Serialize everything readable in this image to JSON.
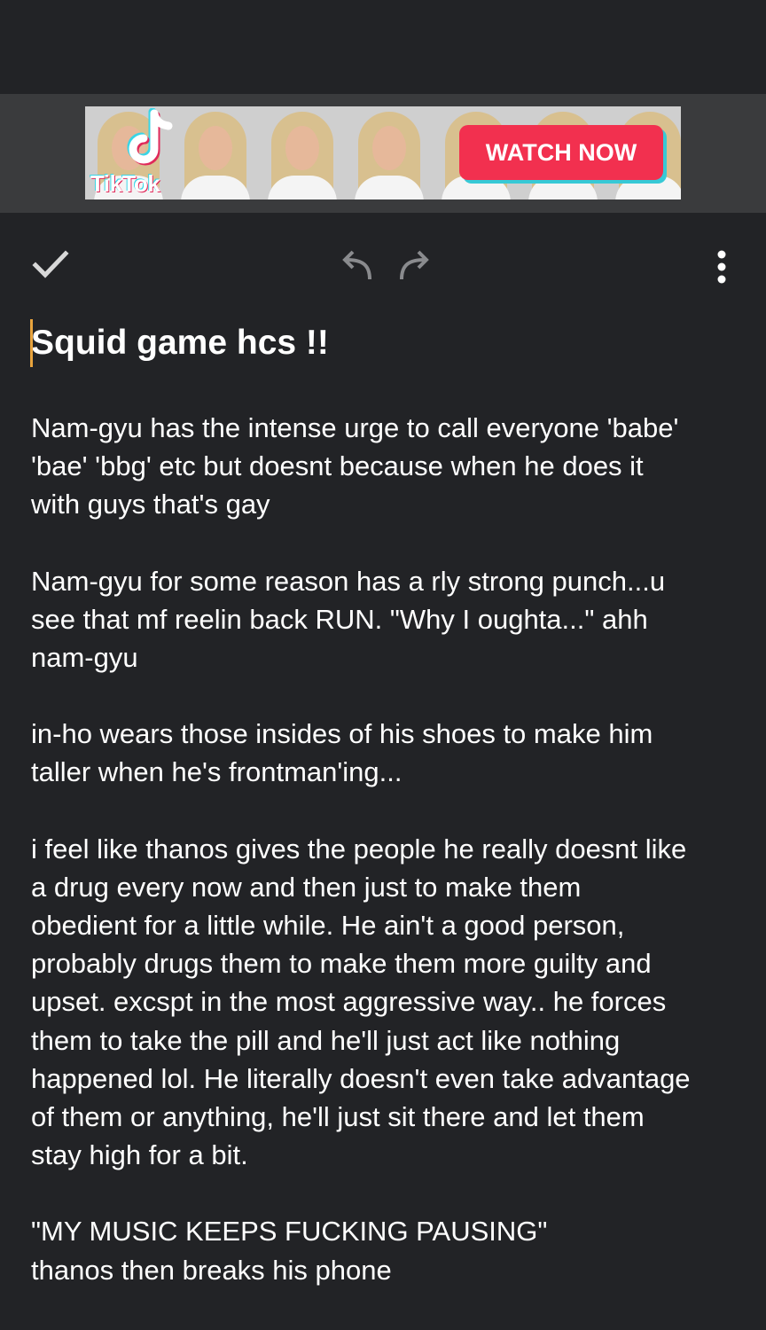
{
  "ad": {
    "brand": "TikTok",
    "cta_label": "WATCH NOW",
    "brand_colors": {
      "red": "#f2304f",
      "cyan": "#37c9d6"
    }
  },
  "toolbar": {
    "done_icon": "check-icon",
    "undo_icon": "undo-icon",
    "redo_icon": "redo-icon",
    "more_icon": "more-vert-icon"
  },
  "note": {
    "title": "Squid game hcs !!",
    "paragraphs": [
      "Nam-gyu has the intense urge to call everyone 'babe'\n'bae' 'bbg' etc but doesnt because when he does it\nwith guys that's gay",
      "Nam-gyu for some reason has a rly strong punch...u\nsee that mf reelin back RUN. \"Why I oughta...\" ahh\nnam-gyu",
      "in-ho wears those insides of his shoes to make him\ntaller when he's frontman'ing...",
      "i feel like thanos gives the people he really doesnt like\na drug every now and then just to make them\nobedient for a little while. He ain't a good person,\nprobably drugs them to make them more guilty and\nupset. excspt in the most aggressive way.. he forces\nthem to take the pill and he'll just act like nothing\nhappened lol. He literally doesn't even take advantage\nof them or anything, he'll just sit there and let them\nstay high for a bit.",
      "\"MY MUSIC KEEPS FUCKING PAUSING\"\nthanos then breaks his phone"
    ]
  },
  "colors": {
    "background": "#222326",
    "ad_strip": "#3a3b3d",
    "cursor": "#e8a33d",
    "text": "#ffffff"
  }
}
